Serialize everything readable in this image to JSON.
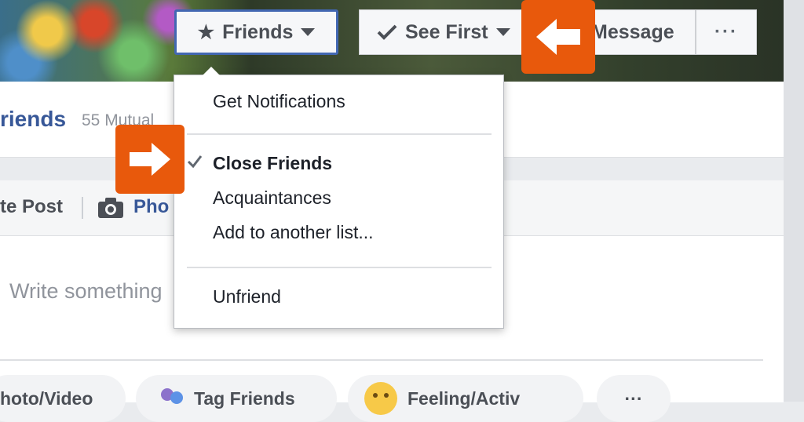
{
  "header": {
    "friends_label": "Friends",
    "see_first_label": "See First",
    "message_label": "Message",
    "more_label": "···"
  },
  "profile": {
    "name_fragment": "riends",
    "mutual_fragment": "55 Mutual"
  },
  "composer": {
    "post_tab": "te Post",
    "photo_tab": "Pho",
    "placeholder": "Write something",
    "pills": {
      "photo_video": "hoto/Video",
      "tag_friends": "Tag Friends",
      "feeling": "Feeling/Activ",
      "more": "···"
    }
  },
  "dropdown": {
    "items": [
      {
        "label": "Get Notifications",
        "checked": false
      },
      {
        "label": "Close Friends",
        "checked": true
      },
      {
        "label": "Acquaintances",
        "checked": false
      },
      {
        "label": "Add to another list...",
        "checked": false
      },
      {
        "label": "Unfriend",
        "checked": false
      }
    ]
  },
  "colors": {
    "accent": "#4267b2",
    "link": "#385898",
    "annotation_arrow": "#e8590c"
  },
  "icons": [
    "star-icon",
    "caret-down-icon",
    "checkmark-icon",
    "camera-icon",
    "tag-icon",
    "smiley-icon",
    "arrow-left-icon",
    "arrow-right-icon"
  ]
}
